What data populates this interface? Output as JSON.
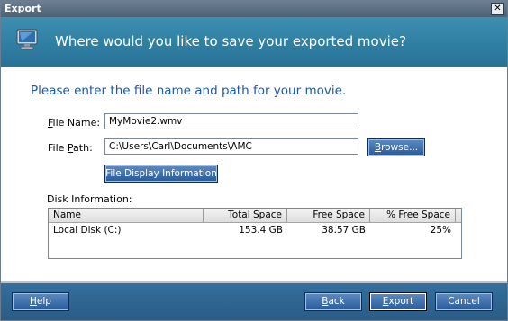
{
  "window": {
    "title": "Export",
    "close_glyph": "✕"
  },
  "header": {
    "text": "Where would you like to save your exported movie?",
    "icon": "monitor-icon"
  },
  "instruction": "Please enter the file name and path for your movie.",
  "file_name": {
    "label_first": "F",
    "label_rest": "ile Name:",
    "value": "MyMovie2.wmv"
  },
  "file_path": {
    "label_pre": "File ",
    "label_u": "P",
    "label_post": "ath:",
    "value": "C:\\Users\\Carl\\Documents\\AMC"
  },
  "browse": {
    "pre": "",
    "u": "B",
    "post": "rowse..."
  },
  "file_display_button": "File Display Information",
  "disk": {
    "label": "Disk Information:",
    "columns": [
      "Name",
      "Total Space",
      "Free Space",
      "% Free Space"
    ],
    "rows": [
      {
        "name": "Local Disk (C:)",
        "total": "153.4 GB",
        "free": "38.57 GB",
        "pct": "25%"
      }
    ]
  },
  "footer": {
    "help": {
      "u": "H",
      "rest": "elp"
    },
    "back": {
      "u": "B",
      "rest": "ack"
    },
    "export": {
      "u": "E",
      "rest": "xport"
    },
    "cancel": "Cancel"
  },
  "colors": {
    "header": "#2f7fa3",
    "instruction": "#1d57a6",
    "footer": "#2f6690",
    "button": "#3b6eab"
  }
}
